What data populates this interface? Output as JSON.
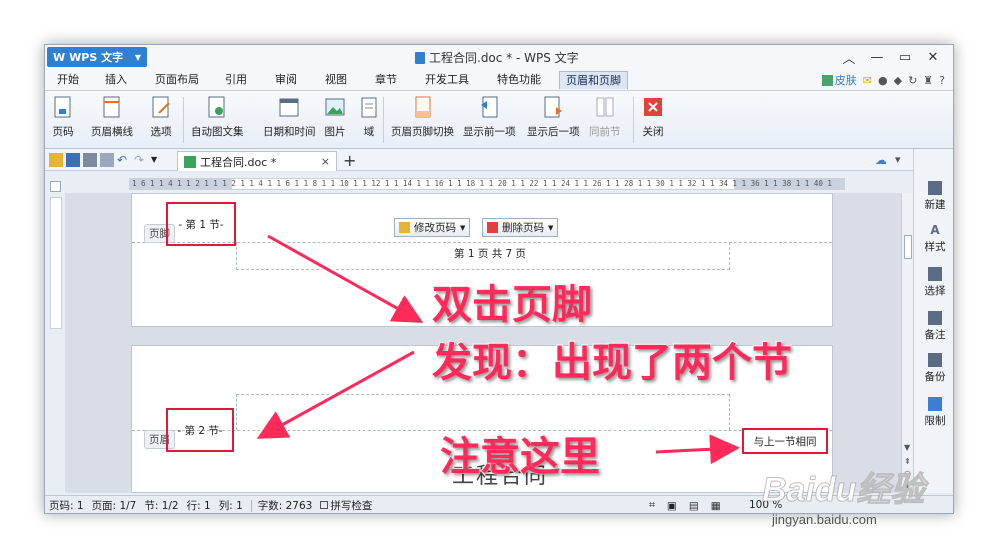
{
  "app": {
    "menu_button": "WPS 文字",
    "window_title": "工程合同.doc * - WPS 文字"
  },
  "menu": {
    "tabs": [
      "开始",
      "插入",
      "页面布局",
      "引用",
      "审阅",
      "视图",
      "章节",
      "开发工具",
      "特色功能",
      "页眉和页脚"
    ],
    "active": "页眉和页脚",
    "skin_label": "皮肤",
    "help": "?"
  },
  "ribbon": {
    "buttons": [
      "页码",
      "页眉横线",
      "选项",
      "自动图文集",
      "日期和时间",
      "图片",
      "域",
      "页眉页脚切换",
      "显示前一项",
      "显示后一项",
      "同前节",
      "关闭"
    ]
  },
  "doc_tab": {
    "name": "工程合同.doc *",
    "close": "×",
    "new": "+"
  },
  "ruler": {
    "text": "1 6 1  1 4 1  1 2 1  1    1 2 1  1 4 1  1 6 1  1 8 1  1 10 1  1 12 1  1 14 1  1 16 1  1 18 1  1 20 1  1 22 1  1 24 1  1 26 1  1 28 1  1 30 1  1 32 1  1 34 1  1 36 1  1 38 1  1 40 1"
  },
  "page1": {
    "footer_tag": "页脚",
    "section_label": "- 第 1 节-",
    "edit_page_num": "修改页码",
    "delete_page_num": "删除页码",
    "page_number_text": "第 1 页 共 7 页"
  },
  "page2": {
    "header_tag": "页眉",
    "section_label": "- 第 2 节-",
    "same_as_previous": "与上一节相同",
    "heading": "工程合同"
  },
  "taskpane": {
    "items": [
      "新建",
      "样式",
      "选择",
      "备注",
      "备份",
      "限制"
    ]
  },
  "statusbar": {
    "page_code": "页码: 1",
    "page": "页面: 1/7",
    "section": "节: 1/2",
    "row": "行: 1",
    "col": "列: 1",
    "word_count": "字数: 2763",
    "spell_check": "拼写检查",
    "zoom": "100 %"
  },
  "annotations": {
    "line1": "双击页脚",
    "line2": "发现：出现了两个节",
    "line3": "注意这里"
  },
  "watermark": {
    "logo": "Baidu经验",
    "url": "jingyan.baidu.com"
  },
  "colors": {
    "accent": "#2f7fd3",
    "annotation": "#ff2a5a",
    "highlight_box": "#e0193a"
  }
}
